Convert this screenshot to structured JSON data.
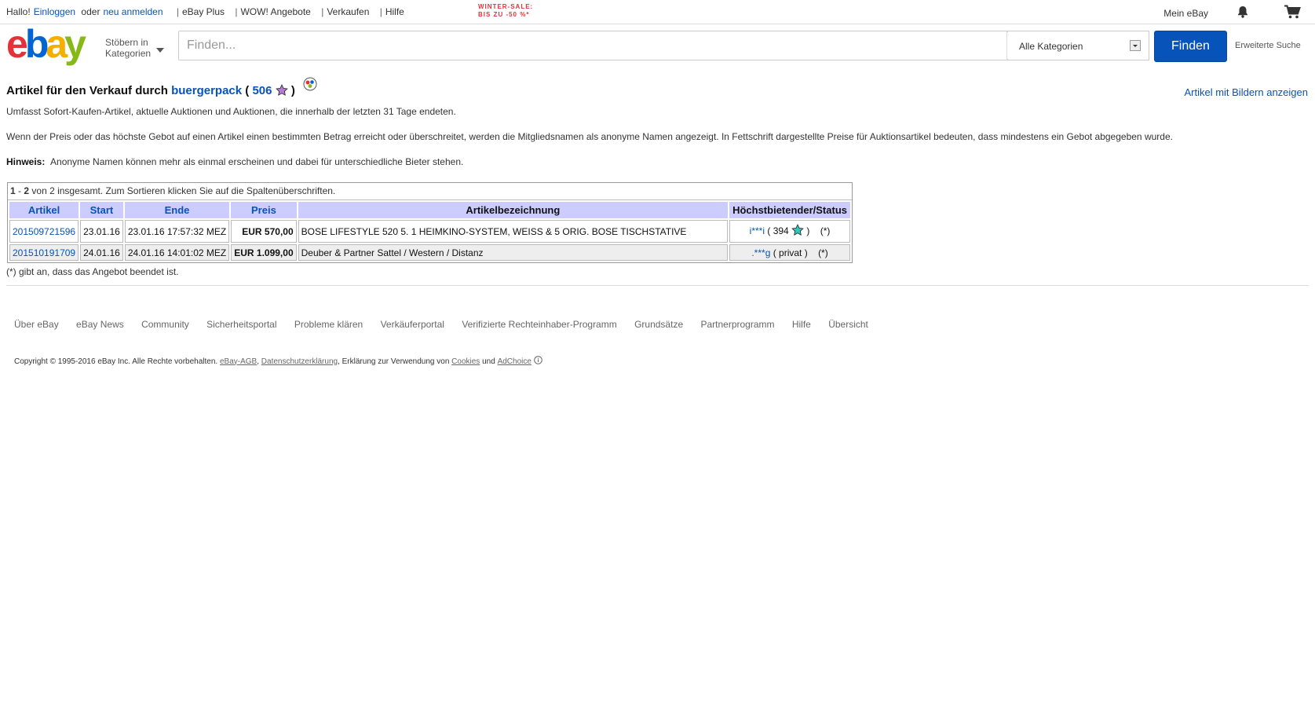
{
  "topbar": {
    "greeting": "Hallo!",
    "login": "Einloggen",
    "or": "oder",
    "register": "neu anmelden",
    "links": [
      "eBay Plus",
      "WOW! Angebote",
      "Verkaufen",
      "Hilfe"
    ],
    "sale_line1": "WINTER-SALE:",
    "sale_line2": "BIS ZU -50 %*",
    "my_ebay": "Mein eBay",
    "icons": {
      "notifications": "bell-icon",
      "cart": "cart-icon"
    }
  },
  "header": {
    "browse_line1": "Stöbern in",
    "browse_line2": "Kategorien",
    "search_placeholder": "Finden...",
    "category": "Alle Kategorien",
    "find_button": "Finden",
    "advanced": "Erweiterte Suche",
    "logo_colors": [
      "#e53238",
      "#0064d2",
      "#f5af02",
      "#86b817"
    ]
  },
  "content": {
    "title_prefix": "Artikel für den Verkauf durch",
    "seller": "buergerpack",
    "seller_score": "506",
    "show_pictures": "Artikel mit Bildern anzeigen",
    "para1": "Umfasst Sofort-Kaufen-Artikel, aktuelle Auktionen und Auktionen, die innerhalb der letzten 31 Tage endeten.",
    "para2": "Wenn der Preis oder das höchste Gebot auf einen Artikel einen bestimmten Betrag erreicht oder überschreitet, werden die Mitgliedsnamen als anonyme Namen angezeigt. In Fettschrift dargestellte Preise für Auktionsartikel bedeuten, dass mindestens ein Gebot abgegeben wurde.",
    "hint_label": "Hinweis:",
    "hint_text": "Anonyme Namen können mehr als einmal erscheinen und dabei für unterschiedliche Bieter stehen."
  },
  "table": {
    "range_from": "1",
    "range_to": "2",
    "caption_rest": "von 2 insgesamt. Zum Sortieren klicken Sie auf die Spaltenüberschriften.",
    "headers": [
      "Artikel",
      "Start",
      "Ende",
      "Preis",
      "Artikelbezeichnung",
      "Höchstbietender/Status"
    ],
    "rows": [
      {
        "item": "201509721596",
        "start": "23.01.16",
        "end": "23.01.16 17:57:32 MEZ",
        "price": "EUR 570,00",
        "title": "BOSE LIFESTYLE 520 5. 1 HEIMKINO-SYSTEM, WEISS & 5 ORIG. BOSE TISCHSTATIVE",
        "bidder": "i***i",
        "bidder_info": "394",
        "status": "(*)"
      },
      {
        "item": "201510191709",
        "start": "24.01.16",
        "end": "24.01.16 14:01:02 MEZ",
        "price": "EUR 1.099,00",
        "title": "Deuber & Partner Sattel / Western / Distanz",
        "bidder": ".***g",
        "bidder_info": "privat",
        "status": "(*)"
      }
    ],
    "note": "(*) gibt an, dass das Angebot beendet ist."
  },
  "footer": {
    "links": [
      "Über eBay",
      "eBay News",
      "Community",
      "Sicherheitsportal",
      "Probleme klären",
      "Verkäuferportal",
      "Verifizierte Rechteinhaber-Programm",
      "Grundsätze",
      "Partnerprogramm",
      "Hilfe",
      "Übersicht"
    ],
    "copyright": "Copyright © 1995-2016 eBay Inc. Alle Rechte vorbehalten.",
    "agb": "eBay-AGB",
    "privacy": "Datenschutzerklärung",
    "cookie_text": "Erklärung zur Verwendung von",
    "cookies": "Cookies",
    "and": "und",
    "adchoice": "AdChoice"
  }
}
